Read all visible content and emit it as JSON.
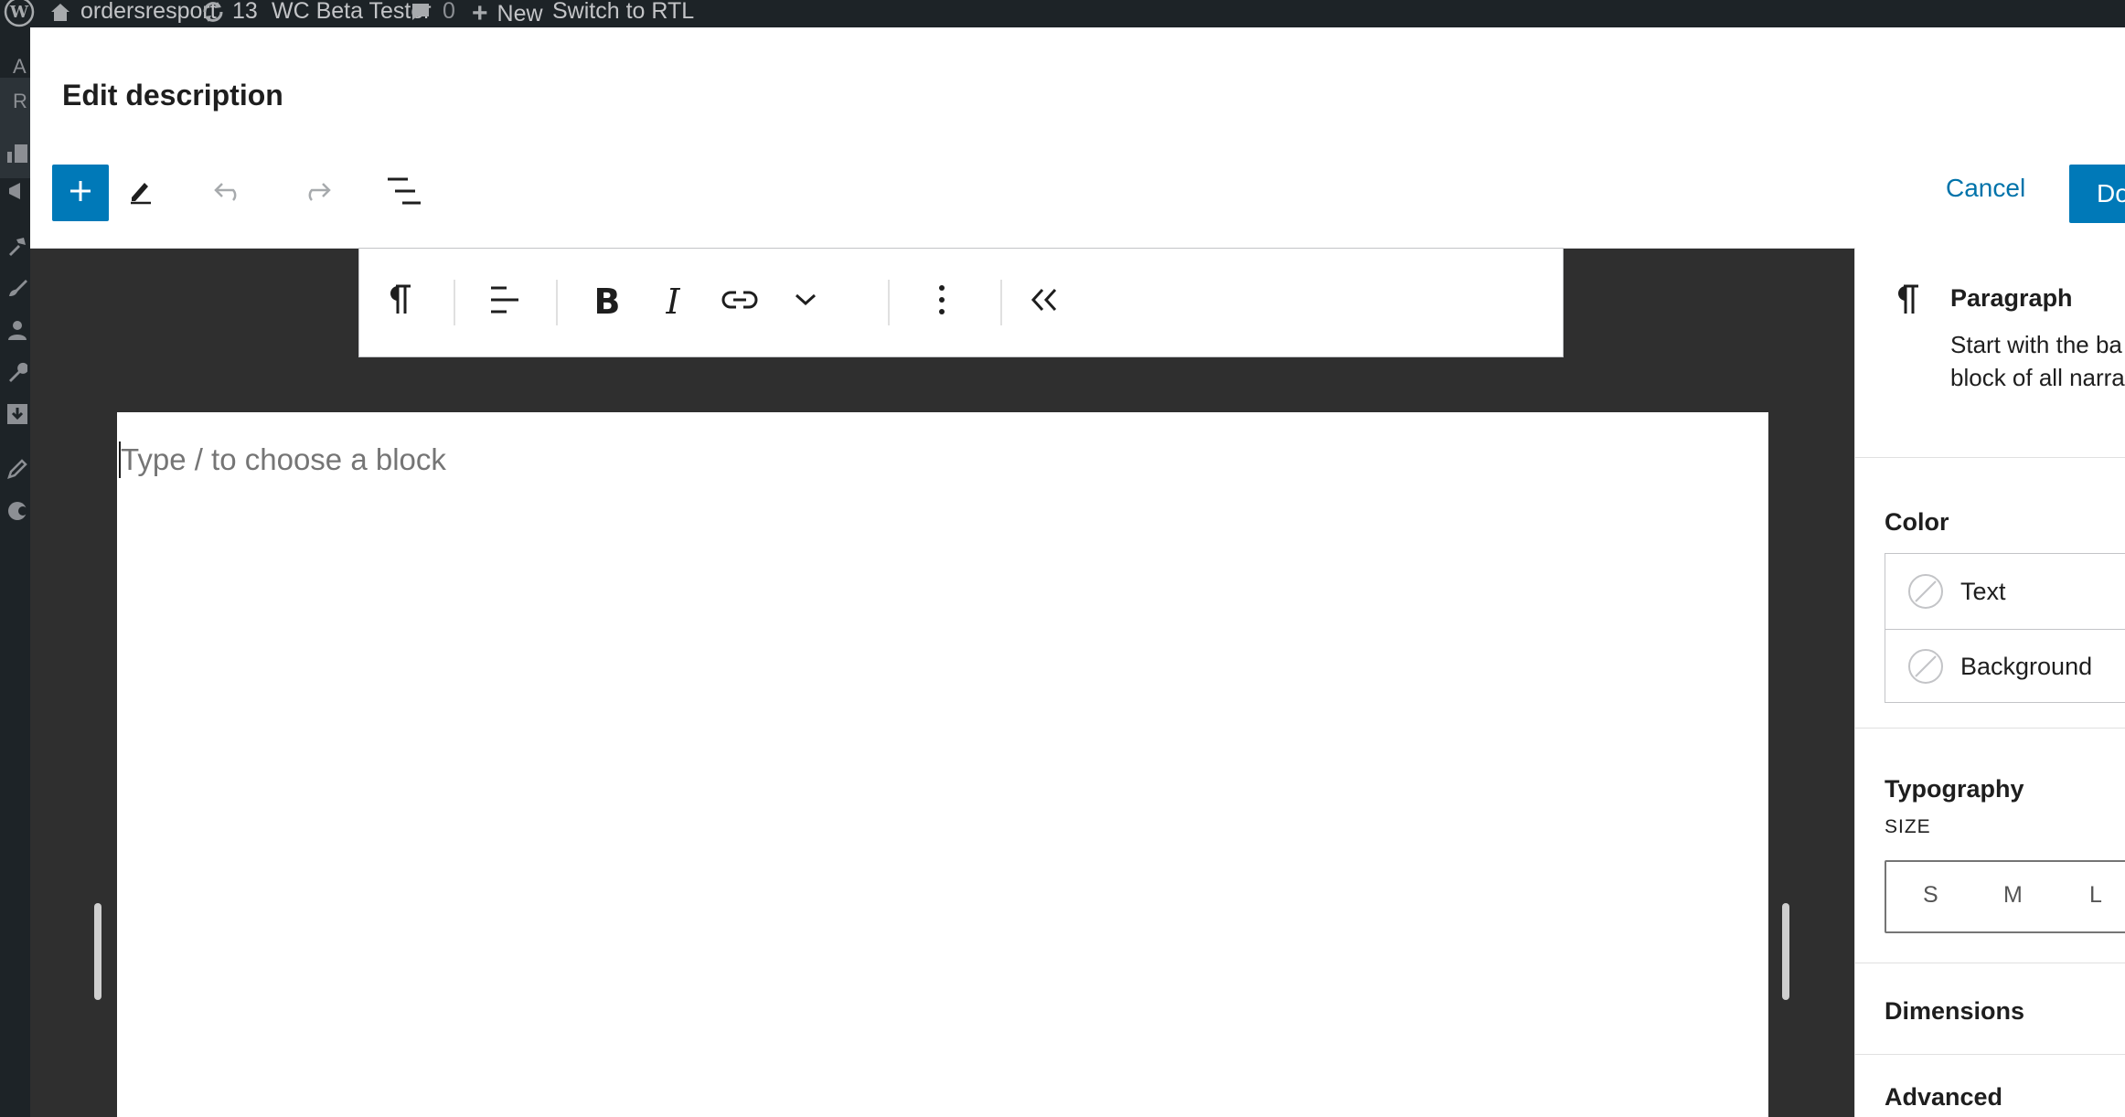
{
  "admin_bar": {
    "site_name": "ordersresport",
    "updates_count": "13",
    "plugin_label": "WC Beta Tester",
    "comments_count": "0",
    "new_label": "New",
    "rtl_label": "Switch to RTL"
  },
  "admin_menu": {
    "letters": [
      "A",
      "R"
    ],
    "icons": [
      "dashboard-icon",
      "megaphone-icon",
      "hammer-icon",
      "brush-icon",
      "users-icon",
      "wrench-icon",
      "import-icon",
      "pen-icon",
      "circle-icon"
    ]
  },
  "modal": {
    "title": "Edit description",
    "toolbar": {
      "inserter_icon": "plus-icon",
      "tools_icon": "pencil-icon",
      "undo_icon": "undo-icon",
      "redo_icon": "redo-icon",
      "outline_icon": "list-view-icon"
    },
    "cancel_label": "Cancel",
    "done_label": "Done",
    "accent_color": "#0079b8"
  },
  "block_toolbar": {
    "buttons": [
      "paragraph-icon",
      "align-icon",
      "bold-icon",
      "italic-icon",
      "link-icon",
      "more-format-chevron-icon",
      "options-icon",
      "collapse-icon"
    ]
  },
  "canvas": {
    "placeholder": "Type / to choose a block"
  },
  "inspector": {
    "block_name": "Paragraph",
    "block_desc_line1": "Start with the ba",
    "block_desc_line2": "block of all narra",
    "color": {
      "title": "Color",
      "items": [
        {
          "label": "Text"
        },
        {
          "label": "Background"
        }
      ]
    },
    "typography": {
      "title": "Typography",
      "size_label": "SIZE",
      "sizes": [
        "S",
        "M",
        "L"
      ]
    },
    "dimensions_title": "Dimensions",
    "advanced_title": "Advanced"
  }
}
